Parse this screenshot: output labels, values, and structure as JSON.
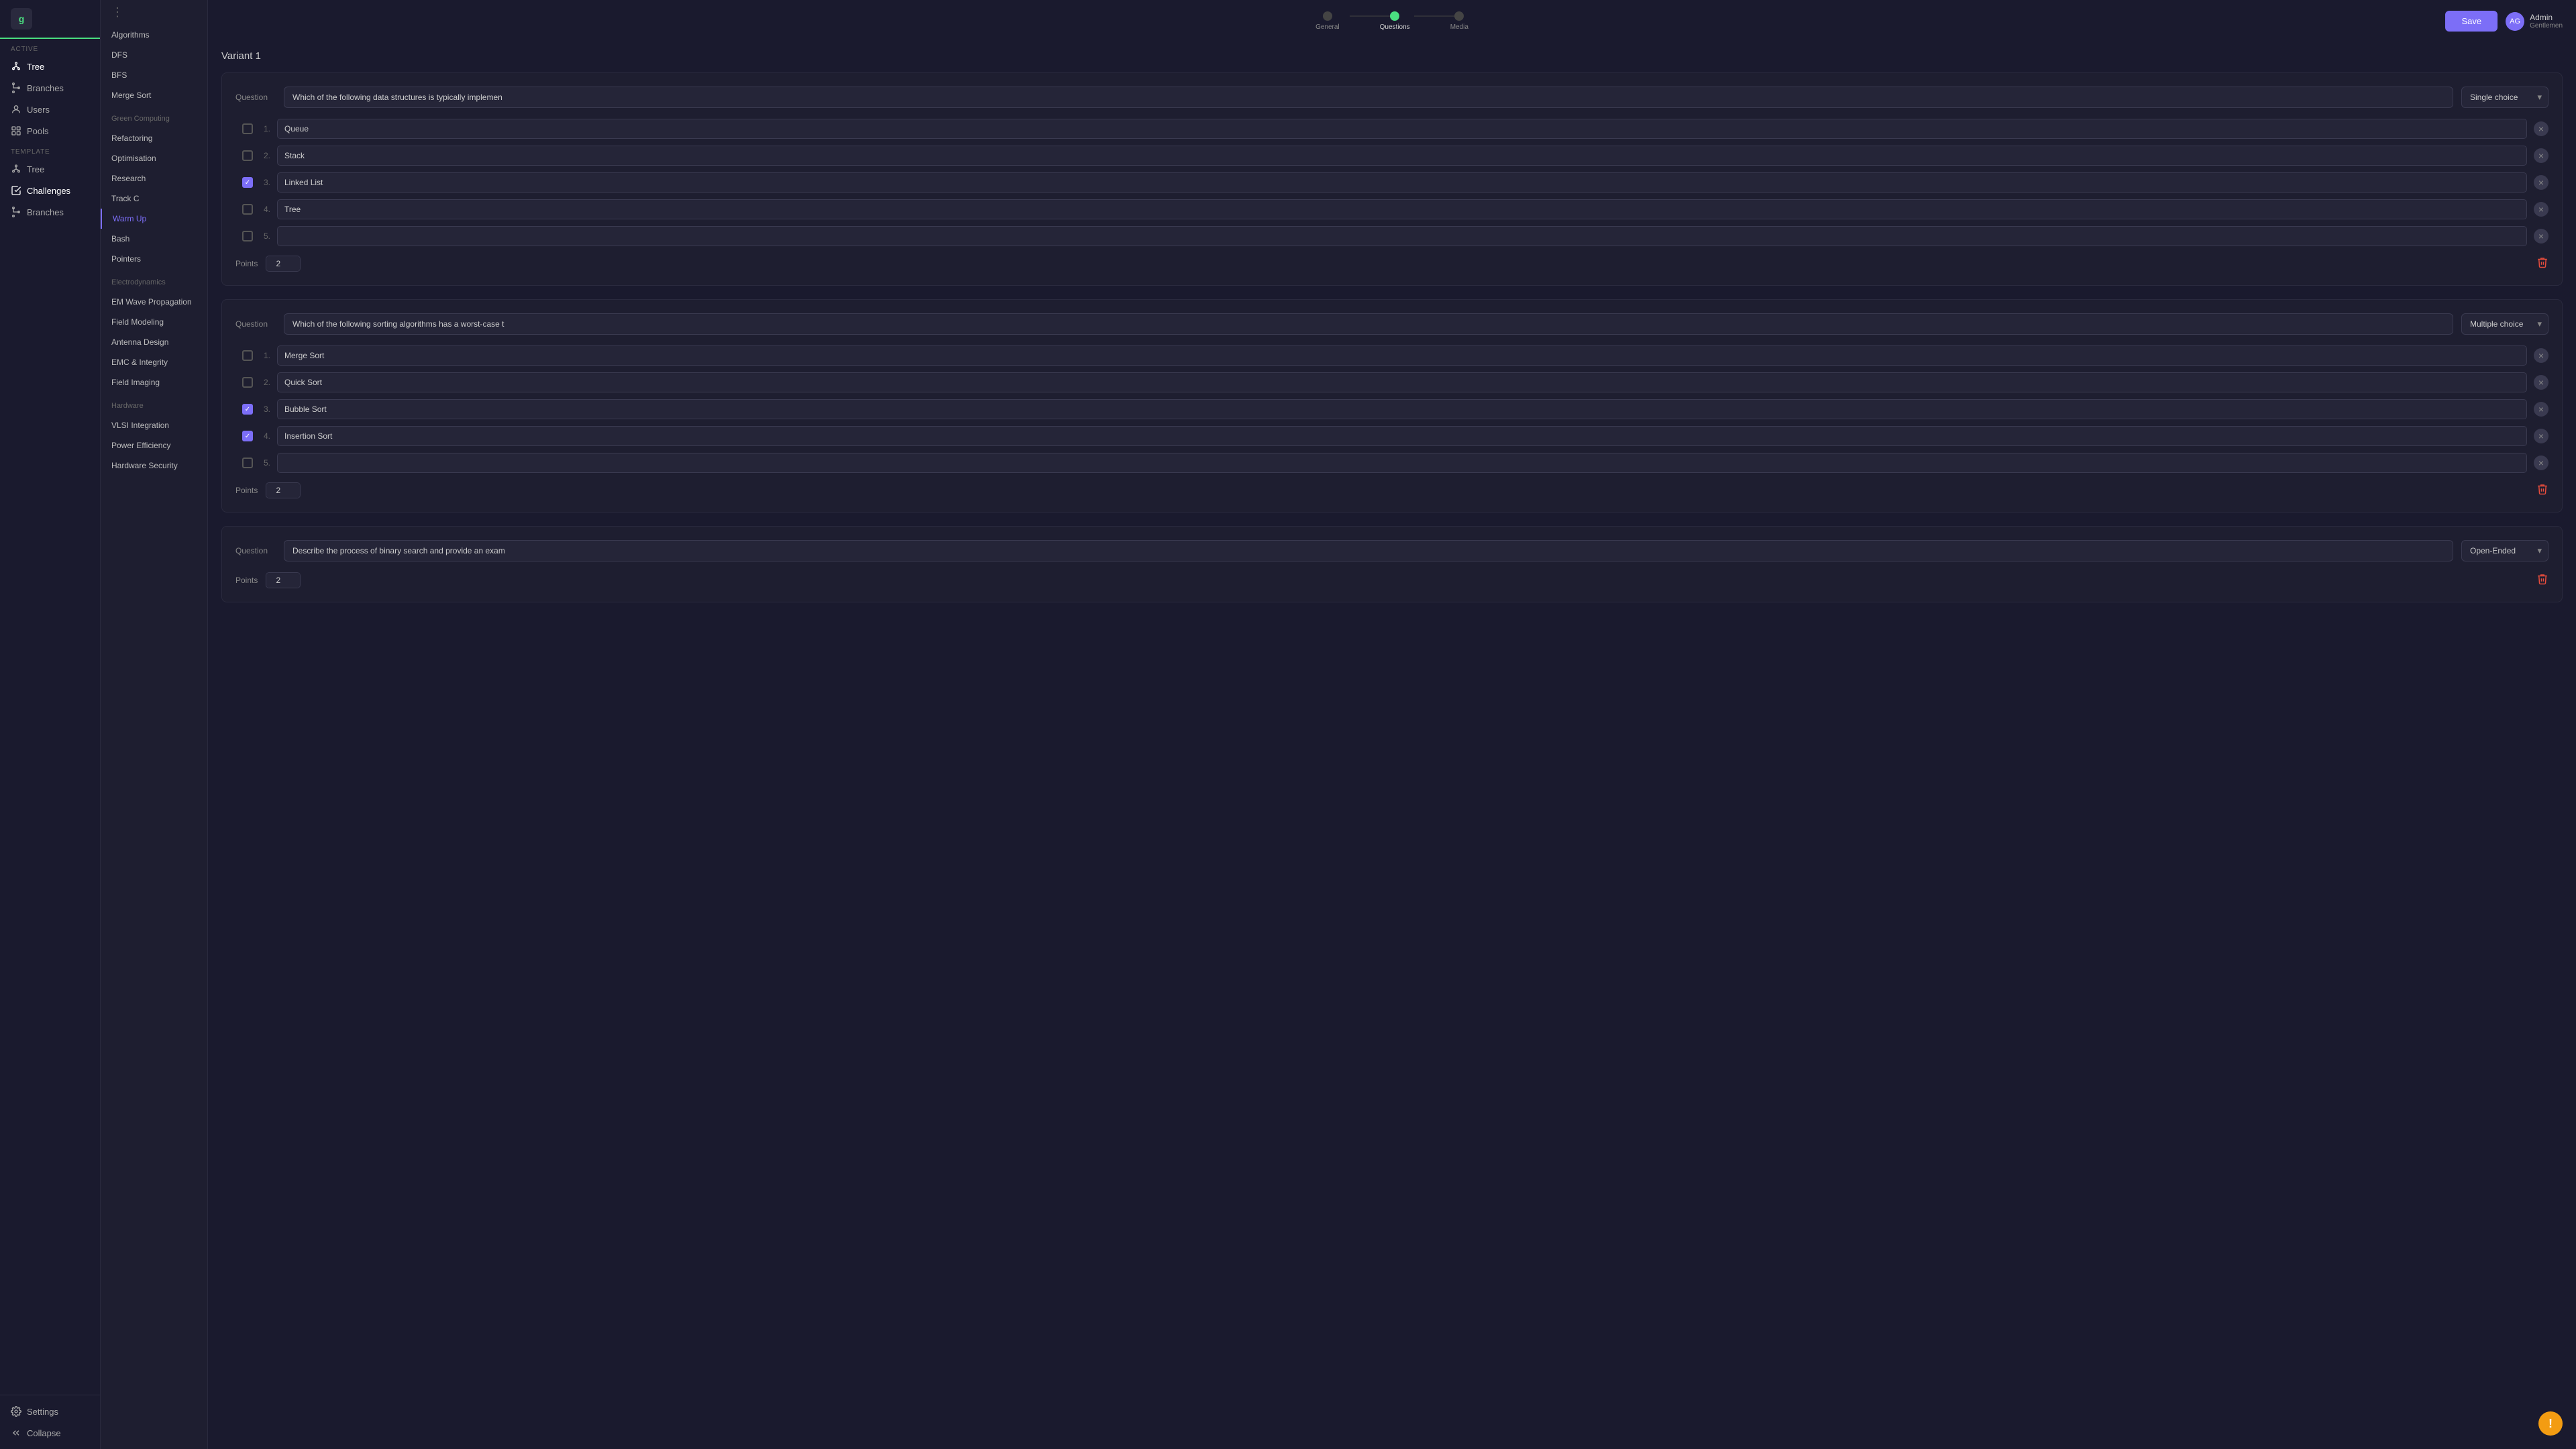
{
  "app": {
    "logo": "g",
    "active_section": "ACTIVE",
    "template_section": "TEMPLATE"
  },
  "sidebar": {
    "active_items": [
      {
        "id": "tree",
        "label": "Tree",
        "icon": "tree"
      },
      {
        "id": "branches",
        "label": "Branches",
        "icon": "branches"
      },
      {
        "id": "users",
        "label": "Users",
        "icon": "user"
      },
      {
        "id": "pools",
        "label": "Pools",
        "icon": "pool"
      }
    ],
    "template_items": [
      {
        "id": "tree-tmpl",
        "label": "Tree",
        "icon": "tree"
      },
      {
        "id": "challenges",
        "label": "Challenges",
        "icon": "challenges",
        "active": true
      },
      {
        "id": "branches-tmpl",
        "label": "Branches",
        "icon": "branches"
      }
    ],
    "bottom_items": [
      {
        "id": "settings",
        "label": "Settings",
        "icon": "gear"
      },
      {
        "id": "collapse",
        "label": "Collapse",
        "icon": "collapse"
      }
    ]
  },
  "secondary_sidebar": {
    "items": [
      {
        "id": "algorithms",
        "label": "Algorithms",
        "category": false
      },
      {
        "id": "dfs",
        "label": "DFS",
        "category": false
      },
      {
        "id": "bfs",
        "label": "BFS",
        "category": false
      },
      {
        "id": "merge-sort",
        "label": "Merge Sort",
        "category": false
      },
      {
        "id": "green-computing",
        "label": "Green Computing",
        "category": true
      },
      {
        "id": "refactoring",
        "label": "Refactoring",
        "category": false
      },
      {
        "id": "optimisation",
        "label": "Optimisation",
        "category": false
      },
      {
        "id": "research",
        "label": "Research",
        "category": false
      },
      {
        "id": "track-c",
        "label": "Track C",
        "category": false
      },
      {
        "id": "warm-up",
        "label": "Warm Up",
        "category": false,
        "active": true
      },
      {
        "id": "bash",
        "label": "Bash",
        "category": false
      },
      {
        "id": "pointers",
        "label": "Pointers",
        "category": false
      },
      {
        "id": "electrodynamics",
        "label": "Electrodynamics",
        "category": true
      },
      {
        "id": "em-wave",
        "label": "EM Wave Propagation",
        "category": false
      },
      {
        "id": "field-modeling",
        "label": "Field Modeling",
        "category": false
      },
      {
        "id": "antenna-design",
        "label": "Antenna Design",
        "category": false
      },
      {
        "id": "emc",
        "label": "EMC & Integrity",
        "category": false
      },
      {
        "id": "field-imaging",
        "label": "Field Imaging",
        "category": false
      },
      {
        "id": "hardware",
        "label": "Hardware",
        "category": true
      },
      {
        "id": "vlsi",
        "label": "VLSI Integration",
        "category": false
      },
      {
        "id": "power-efficiency",
        "label": "Power Efficiency",
        "category": false
      },
      {
        "id": "hardware-security",
        "label": "Hardware Security",
        "category": false
      }
    ]
  },
  "stepper": {
    "steps": [
      {
        "id": "general",
        "label": "General",
        "active": false
      },
      {
        "id": "questions",
        "label": "Questions",
        "active": true
      },
      {
        "id": "media",
        "label": "Media",
        "active": false
      }
    ]
  },
  "header": {
    "save_label": "Save",
    "user_name": "Admin",
    "user_sub": "Gentlemen"
  },
  "variant_label": "Variant 1",
  "questions": [
    {
      "id": "q1",
      "label": "Question",
      "question_text": "Which of the following data structures is typically implemen",
      "type": "Single choice",
      "type_options": [
        "Single choice",
        "Multiple choice",
        "Open-Ended"
      ],
      "answers": [
        {
          "num": "1.",
          "text": "Queue",
          "checked": false
        },
        {
          "num": "2.",
          "text": "Stack",
          "checked": false
        },
        {
          "num": "3.",
          "text": "Linked List",
          "checked": true
        },
        {
          "num": "4.",
          "text": "Tree",
          "checked": false
        },
        {
          "num": "5.",
          "text": "",
          "checked": false
        }
      ],
      "points_label": "Points",
      "points_value": "2"
    },
    {
      "id": "q2",
      "label": "Question",
      "question_text": "Which of the following sorting algorithms has a worst-case t",
      "type": "Multiple choice",
      "type_options": [
        "Single choice",
        "Multiple choice",
        "Open-Ended"
      ],
      "answers": [
        {
          "num": "1.",
          "text": "Merge Sort",
          "checked": false
        },
        {
          "num": "2.",
          "text": "Quick Sort",
          "checked": false
        },
        {
          "num": "3.",
          "text": "Bubble Sort",
          "checked": true
        },
        {
          "num": "4.",
          "text": "Insertion Sort",
          "checked": true
        },
        {
          "num": "5.",
          "text": "",
          "checked": false
        }
      ],
      "points_label": "Points",
      "points_value": "2"
    },
    {
      "id": "q3",
      "label": "Question",
      "question_text": "Describe the process of binary search and provide an exam",
      "type": "Open-Ended",
      "type_options": [
        "Single choice",
        "Multiple choice",
        "Open-Ended"
      ],
      "answers": [],
      "points_label": "Points",
      "points_value": "2"
    }
  ]
}
